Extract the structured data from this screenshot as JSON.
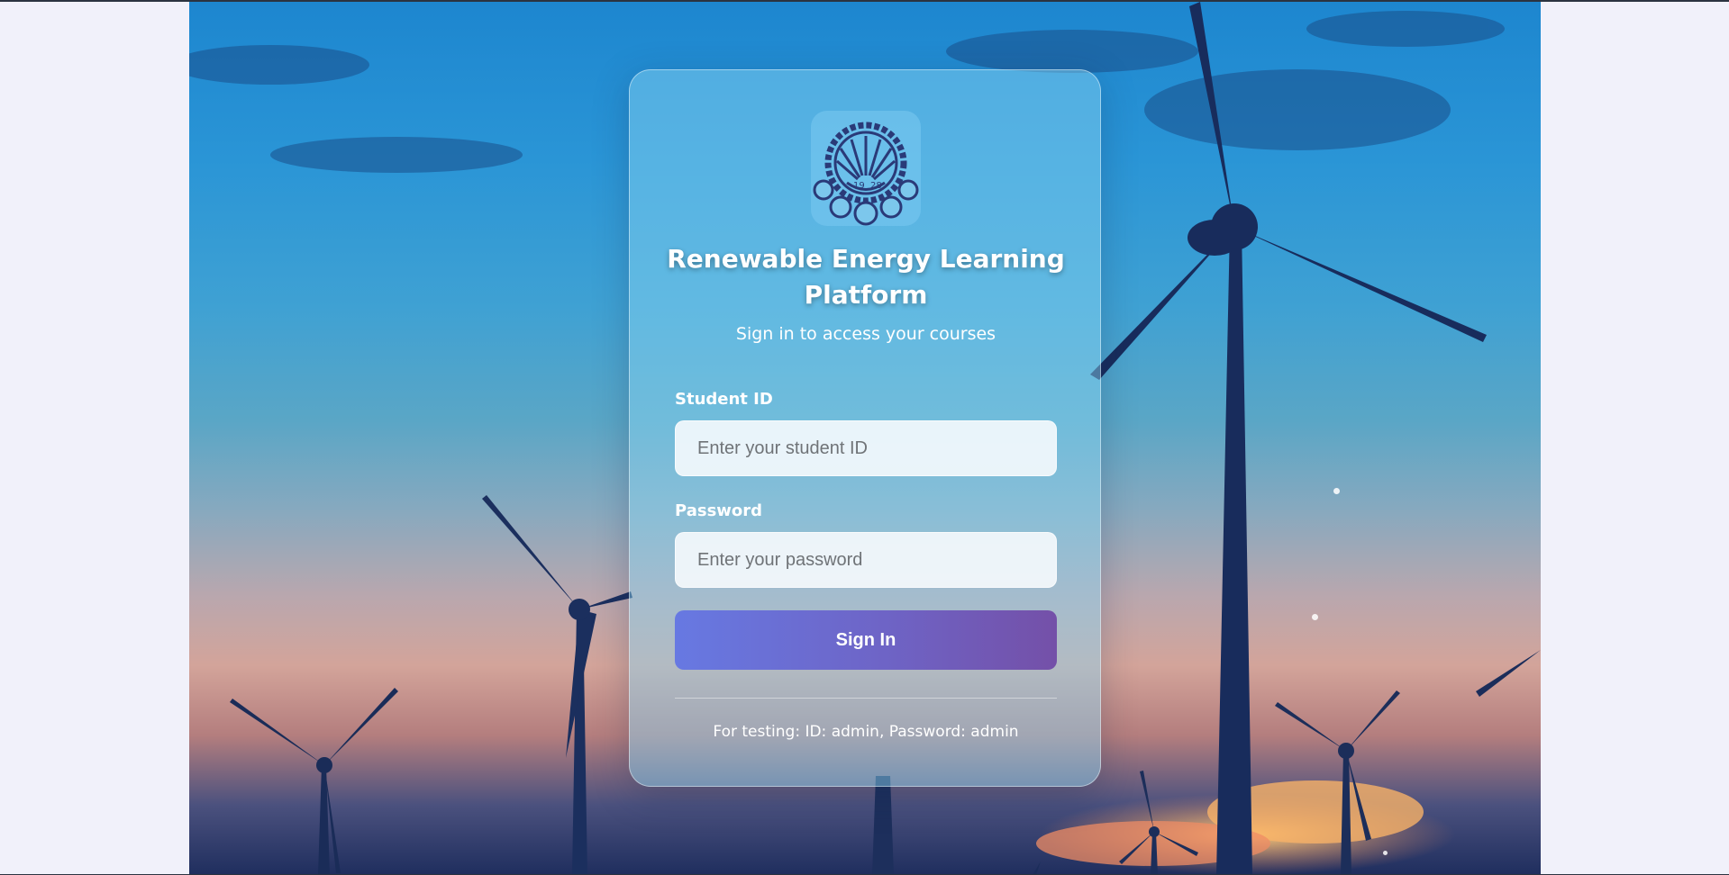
{
  "login": {
    "title": "Renewable Energy Learning Platform",
    "subtitle": "Sign in to access your courses",
    "student_id": {
      "label": "Student ID",
      "placeholder": "Enter your student ID",
      "value": ""
    },
    "password": {
      "label": "Password",
      "placeholder": "Enter your password",
      "value": ""
    },
    "submit_label": "Sign In",
    "hint": "For testing: ID: admin, Password: admin",
    "logo": {
      "icon": "university-seal-icon",
      "year_left": "19",
      "year_right": "28"
    }
  },
  "colors": {
    "page_background": "#f1f1fa",
    "button_gradient_start": "#6779e2",
    "button_gradient_end": "#7450a8",
    "seal_color": "#2a3a78"
  }
}
